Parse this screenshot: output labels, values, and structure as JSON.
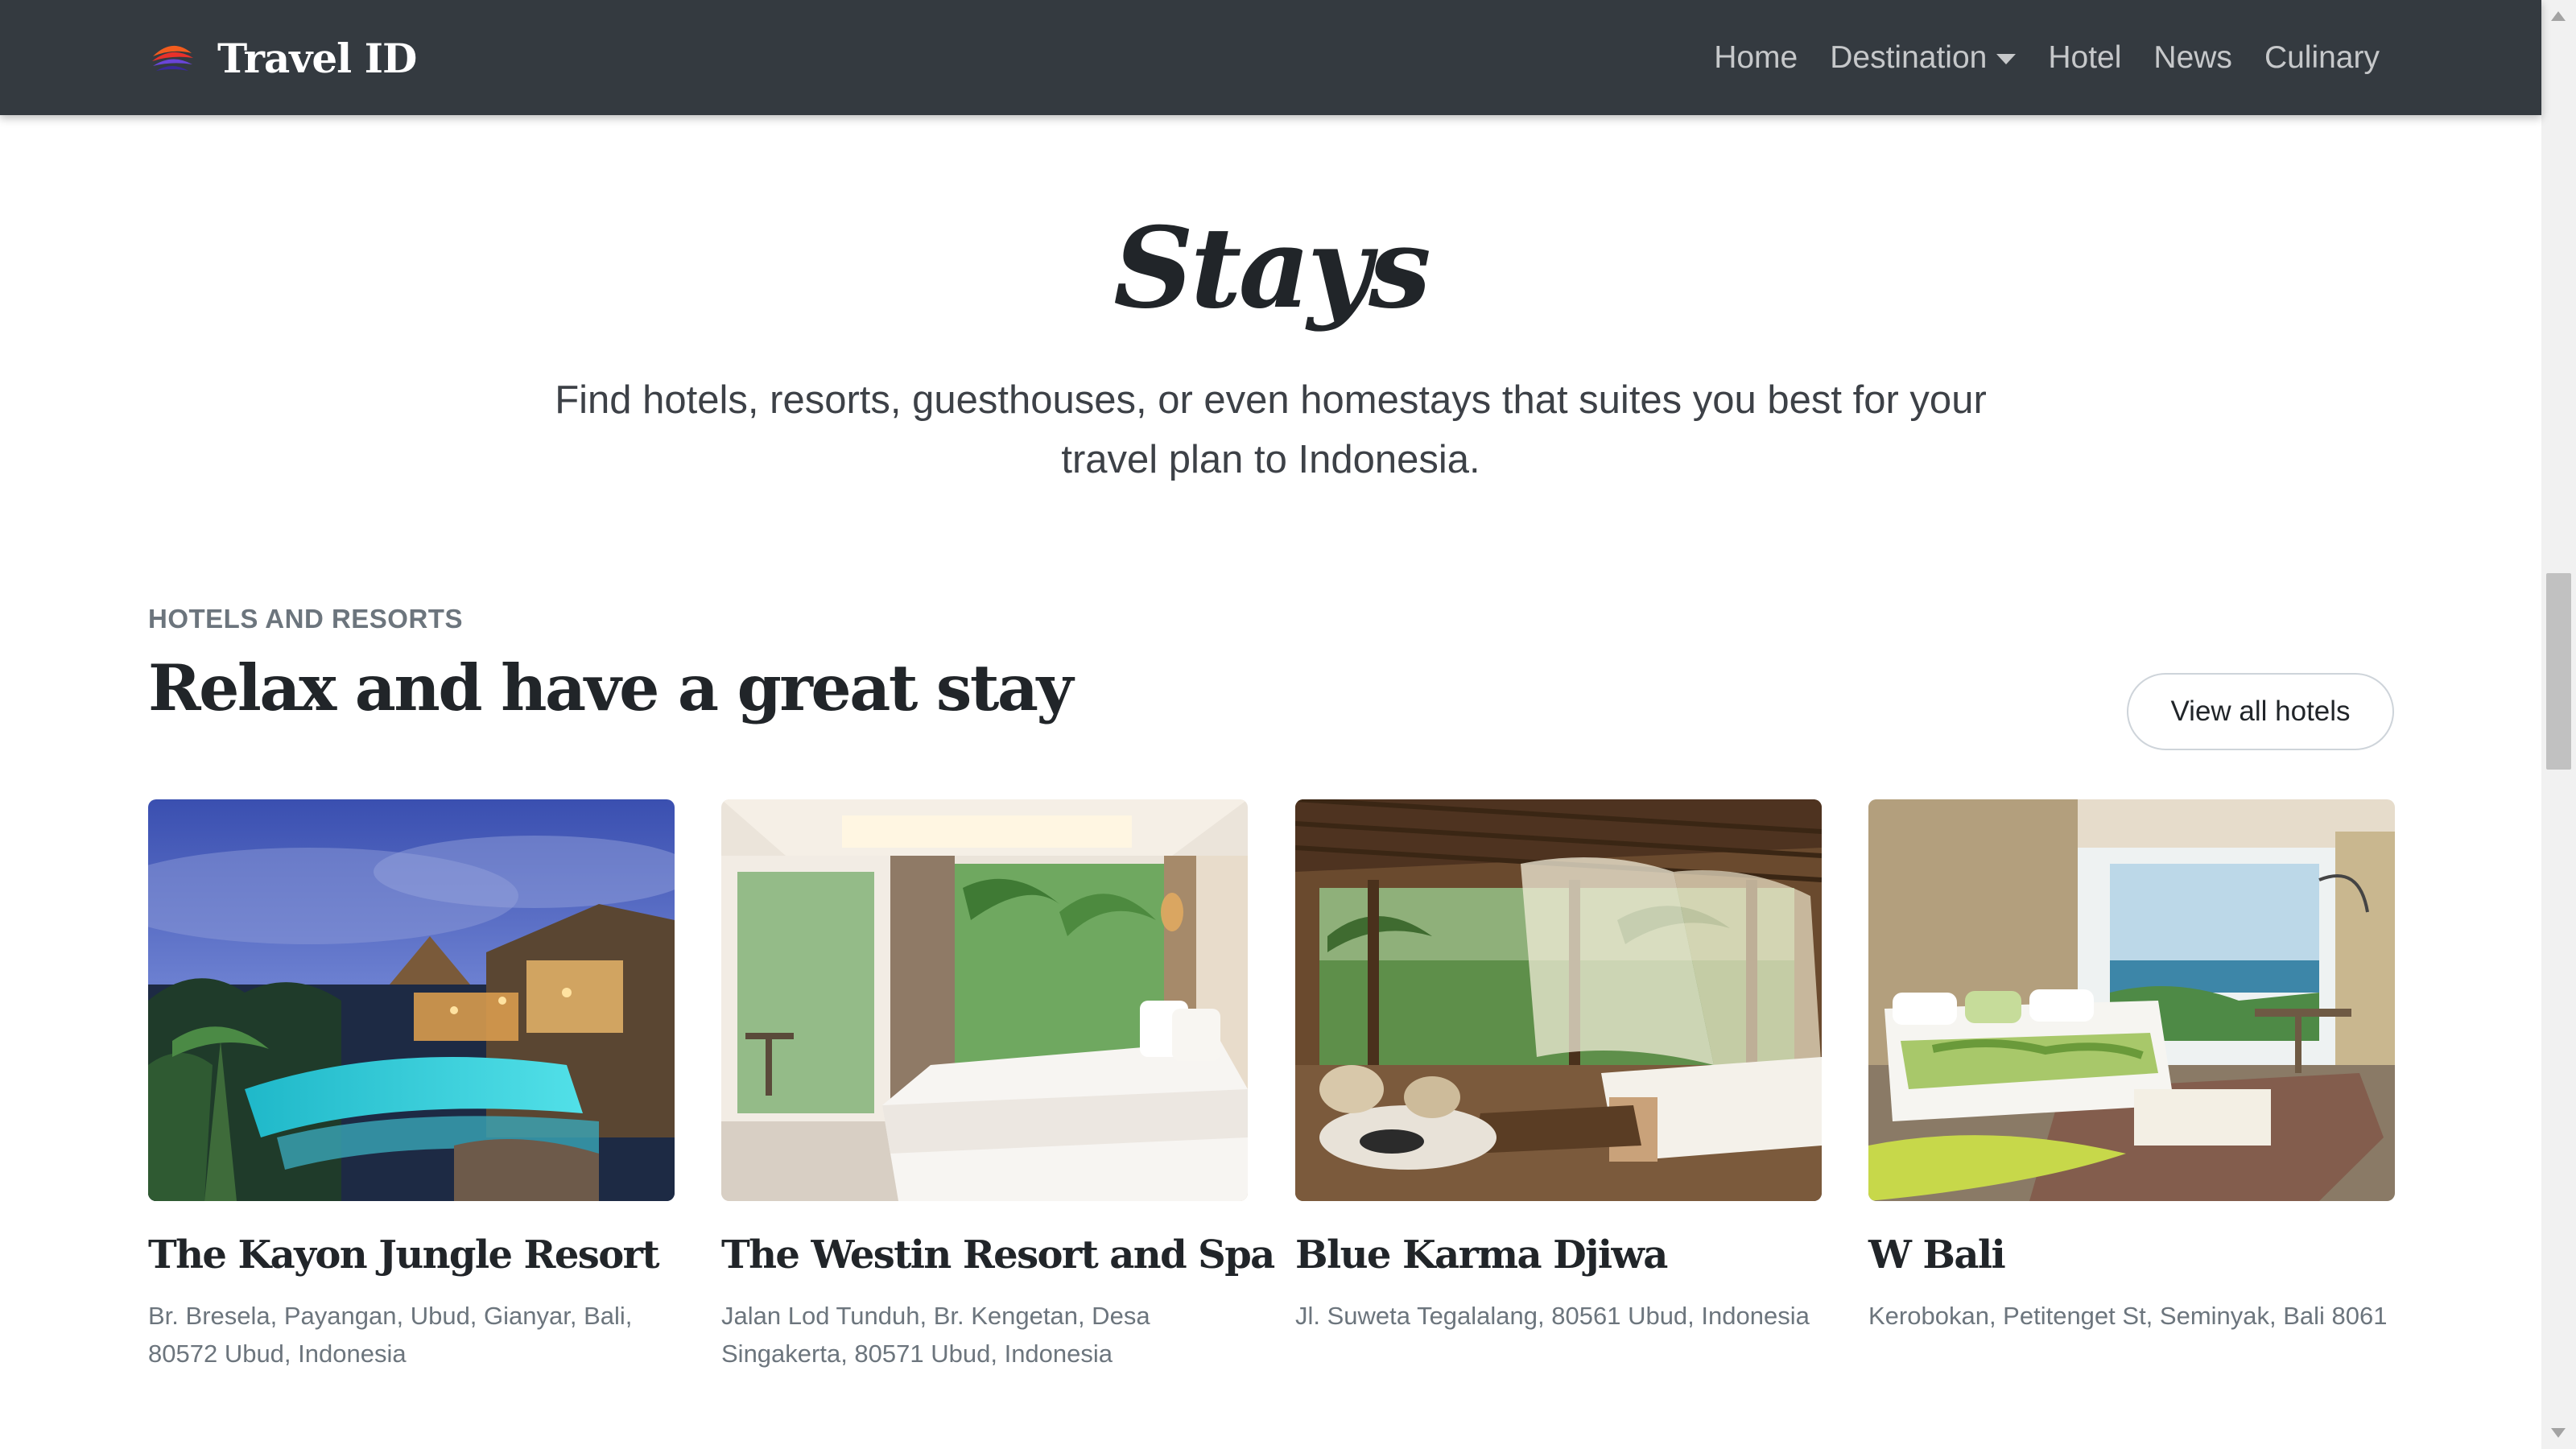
{
  "navbar": {
    "brand": "Travel ID",
    "links": [
      {
        "label": "Home"
      },
      {
        "label": "Destination"
      },
      {
        "label": "Hotel"
      },
      {
        "label": "News"
      },
      {
        "label": "Culinary"
      }
    ]
  },
  "hero": {
    "title": "Stays",
    "subtitle": "Find hotels, resorts, guesthouses, or even homestays that suites you best for your travel plan to Indonesia."
  },
  "section": {
    "eyebrow": "HOTELS AND RESORTS",
    "title": "Relax and have a great stay",
    "view_all_label": "View all hotels"
  },
  "hotels": [
    {
      "name": "The Kayon Jungle Resort",
      "address": "Br. Bresela, Payangan, Ubud, Gianyar, Bali, 80572 Ubud, Indonesia"
    },
    {
      "name": "The Westin Resort and Spa",
      "address": "Jalan Lod Tunduh, Br. Kengetan, Desa Singakerta, 80571 Ubud, Indonesia"
    },
    {
      "name": "Blue Karma Djiwa",
      "address": "Jl. Suweta Tegalalang, 80561 Ubud, Indonesia"
    },
    {
      "name": "W Bali",
      "address": "Kerobokan, Petitenget St, Seminyak, Bali 8061"
    }
  ],
  "icons": {
    "logo": "travel-id-logo",
    "dropdown": "caret-down-icon"
  },
  "colors": {
    "navbar_bg": "#343a40",
    "nav_text": "#ffffffb8",
    "heading": "#212529",
    "muted": "#6c757d"
  }
}
